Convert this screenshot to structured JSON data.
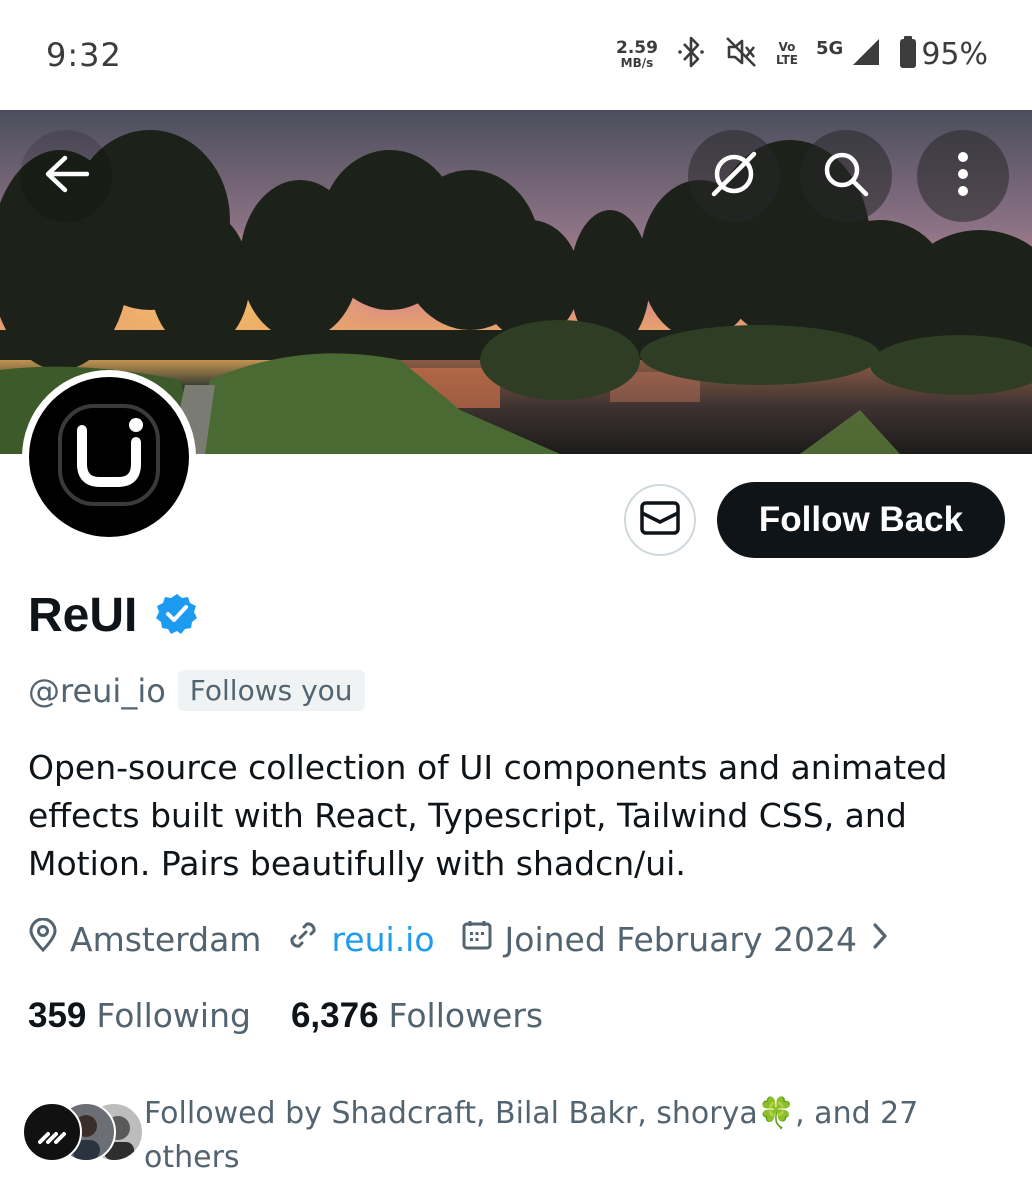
{
  "status_bar": {
    "time": "9:32",
    "net_speed_value": "2.59",
    "net_speed_unit": "MB/s",
    "volte_top": "Vo",
    "volte_bottom": "LTE",
    "network": "5G",
    "battery": "95%"
  },
  "profile": {
    "name": "ReUI",
    "handle": "@reui_io",
    "follows_you": "Follows you",
    "bio": "Open-source collection of UI components and animated effects built with React, Typescript, Tailwind CSS, and Motion. Pairs beautifully with shadcn/ui.",
    "location": "Amsterdam",
    "website": "reui.io",
    "joined": "Joined February 2024",
    "following_count": "359",
    "following_label": "Following",
    "followers_count": "6,376",
    "followers_label": "Followers",
    "followed_by": "Followed by Shadcraft, Bilal Bakr, shorya🍀, and 27 others"
  },
  "actions": {
    "follow_back": "Follow Back"
  },
  "colors": {
    "accent": "#1d9bf0",
    "text_primary": "#0f1419",
    "text_secondary": "#536471",
    "follow_button_bg": "#0f1419"
  },
  "icons": [
    "back-arrow-icon",
    "grok-icon",
    "search-icon",
    "more-vertical-icon",
    "mail-icon",
    "verified-badge-icon",
    "location-pin-icon",
    "link-icon",
    "calendar-icon",
    "chevron-right-icon"
  ]
}
